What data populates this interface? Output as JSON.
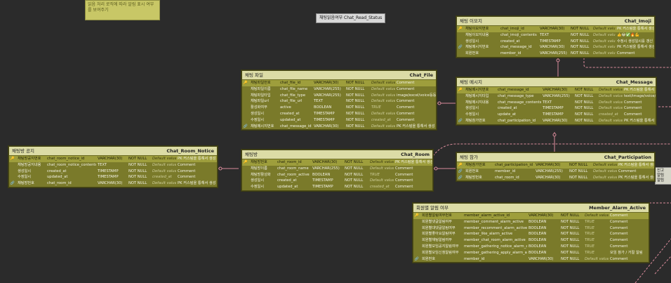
{
  "sticky_note": {
    "text": "읽음 처리 로직에 따라 알림 표시 여부를 보여주기"
  },
  "diagram_label": {
    "text": "채팅읽음여부   Chat_Read_Status"
  },
  "entities": {
    "chat_imoji": {
      "logical": "채팅 이모지",
      "physical": "Chat_Imoji",
      "rows": [
        {
          "key": "pk",
          "name": "채팅이모지번호",
          "col": "chat_imoji_id",
          "type": "VARCHAR(30)",
          "nn": "NOT NULL",
          "dv": "Default value",
          "comment": "PK 커스텀을 통해서 생성"
        },
        {
          "key": "",
          "name": "채팅이모지내용",
          "col": "chat_imoji_contents",
          "type": "TEXT",
          "nn": "NOT NULL",
          "dv": "Default value",
          "comment": "👍😂✅🔥💪"
        },
        {
          "key": "",
          "name": "생성일시",
          "col": "created_at",
          "type": "TIMESTAMP",
          "nn": "NOT NULL",
          "dv": "Default value",
          "comment": "수정시 생성일시를 갱신"
        },
        {
          "key": "fk",
          "name": "채팅메시지번호",
          "col": "chat_message_id",
          "type": "VARCHAR(30)",
          "nn": "NOT NULL",
          "dv": "Default value",
          "comment": "PK 커스텀을 통해서 생성"
        },
        {
          "key": "",
          "name": "회원번호",
          "col": "member_id",
          "type": "VARCHAR(255)",
          "nn": "NOT NULL",
          "dv": "Default value",
          "comment": "Comment"
        }
      ]
    },
    "chat_file": {
      "logical": "채팅 파일",
      "physical": "Chat_File",
      "rows": [
        {
          "key": "pk",
          "name": "채팅파일번호",
          "col": "chat_file_id",
          "type": "VARCHAR(30)",
          "nn": "NOT NULL",
          "dv": "Default value",
          "comment": "Comment"
        },
        {
          "key": "",
          "name": "채팅파일이름",
          "col": "chat_file_name",
          "type": "VARCHAR(255)",
          "nn": "NOT NULL",
          "dv": "Default value",
          "comment": "Comment"
        },
        {
          "key": "",
          "name": "채팅파일타입",
          "col": "chat_file_type",
          "type": "VARCHAR(255)",
          "nn": "NOT NULL",
          "dv": "Default value",
          "comment": "image/excel/voice등등"
        },
        {
          "key": "",
          "name": "채팅파일url",
          "col": "chat_file_url",
          "type": "TEXT",
          "nn": "NOT NULL",
          "dv": "Default value",
          "comment": "Comment"
        },
        {
          "key": "",
          "name": "활성화여부",
          "col": "active",
          "type": "BOOLEAN",
          "nn": "NOT NULL",
          "dv": "TRUE",
          "comment": "Comment"
        },
        {
          "key": "",
          "name": "생성일시",
          "col": "created_at",
          "type": "TIMESTAMP",
          "nn": "NOT NULL",
          "dv": "Default value",
          "comment": "Comment"
        },
        {
          "key": "",
          "name": "수정일시",
          "col": "updated_at",
          "type": "TIMESTAMP",
          "nn": "NOT NULL",
          "dv": "created_at",
          "comment": "Comment"
        },
        {
          "key": "fk",
          "name": "채팅메시지번호",
          "col": "chat_message_id",
          "type": "VARCHAR(30)",
          "nn": "NOT NULL",
          "dv": "Default value",
          "comment": "PK 커스텀을 통해서 생성"
        }
      ]
    },
    "chat_message": {
      "logical": "채팅 메시지",
      "physical": "Chat_Message",
      "rows": [
        {
          "key": "pk",
          "name": "채팅메시지번호",
          "col": "chat_message_id",
          "type": "VARCHAR(30)",
          "nn": "NOT NULL",
          "dv": "Default value",
          "comment": "PK 커스텀을 통해서 생성"
        },
        {
          "key": "",
          "name": "채팅메시지타입",
          "col": "chat_message_type",
          "type": "VARCHAR(255)",
          "nn": "NOT NULL",
          "dv": "Default value",
          "comment": "text/image/voice/URL"
        },
        {
          "key": "",
          "name": "채팅메시지내용",
          "col": "chat_message_contents",
          "type": "TEXT",
          "nn": "NOT NULL",
          "dv": "Default value",
          "comment": "Comment"
        },
        {
          "key": "",
          "name": "생성일시",
          "col": "created_at",
          "type": "TIMESTAMP",
          "nn": "NOT NULL",
          "dv": "Default value",
          "comment": "Comment"
        },
        {
          "key": "",
          "name": "수정일시",
          "col": "update_at",
          "type": "TIMESTAMP",
          "nn": "NOT NULL",
          "dv": "created_at",
          "comment": "Comment"
        },
        {
          "key": "fk",
          "name": "채팅참가번호",
          "col": "chat_participation_id",
          "type": "VARCHAR(30)",
          "nn": "NOT NULL",
          "dv": "Default value",
          "comment": "PK 커스텀을 통해서 생성"
        }
      ]
    },
    "chat_room_notice": {
      "logical": "채팅방 공지",
      "physical": "Chat_Room_Notice",
      "rows": [
        {
          "key": "pk",
          "name": "채팅방공지번호",
          "col": "chat_room_notice_id",
          "type": "VARCHAR(30)",
          "nn": "NOT NULL",
          "dv": "Default value",
          "comment": "PK 커스텀을 통해서 생성"
        },
        {
          "key": "",
          "name": "채팅방공지내용",
          "col": "chat_room_notice_contents",
          "type": "TEXT",
          "nn": "NOT NULL",
          "dv": "Default value",
          "comment": "Comment"
        },
        {
          "key": "",
          "name": "생성일시",
          "col": "created_at",
          "type": "TIMESTAMP",
          "nn": "NOT NULL",
          "dv": "Default value",
          "comment": "Comment"
        },
        {
          "key": "",
          "name": "수정일시",
          "col": "updated_at",
          "type": "TIMESTAMP",
          "nn": "NOT NULL",
          "dv": "created_at",
          "comment": "Comment"
        },
        {
          "key": "fk",
          "name": "채팅방번호",
          "col": "chat_room_id",
          "type": "VARCHAR(30)",
          "nn": "NOT NULL",
          "dv": "Default value",
          "comment": "PK 커스텀을 통해서 생성"
        }
      ]
    },
    "chat_room": {
      "logical": "채팅방",
      "physical": "Chat_Room",
      "rows": [
        {
          "key": "pk",
          "name": "채팅방번호",
          "col": "chat_room_id",
          "type": "VARCHAR(30)",
          "nn": "NOT NULL",
          "dv": "Default value",
          "comment": "PK 커스텀을 통해서 생성"
        },
        {
          "key": "",
          "name": "채팅방이름",
          "col": "chat_room_name",
          "type": "VARCHAR(255)",
          "nn": "NOT NULL",
          "dv": "Default value",
          "comment": "Comment"
        },
        {
          "key": "",
          "name": "채팅방활성화",
          "col": "chat_room_active",
          "type": "BOOLEAN",
          "nn": "NOT NULL",
          "dv": "TRUE",
          "comment": "Comment"
        },
        {
          "key": "",
          "name": "생성일시",
          "col": "created_at",
          "type": "TIMESTAMP",
          "nn": "NOT NULL",
          "dv": "Default value",
          "comment": "Comment"
        },
        {
          "key": "",
          "name": "수정일시",
          "col": "updated_at",
          "type": "TIMESTAMP",
          "nn": "NOT NULL",
          "dv": "created_at",
          "comment": "Comment"
        }
      ]
    },
    "chat_participation": {
      "logical": "채팅 참가",
      "physical": "Chat_Participation",
      "rows": [
        {
          "key": "pk",
          "name": "채팅참가번호",
          "col": "chat_participation_id",
          "type": "VARCHAR(30)",
          "nn": "NOT NULL",
          "dv": "Default value",
          "comment": "PK 커스텀을 통해서 생성"
        },
        {
          "key": "fk",
          "name": "회원번호",
          "col": "member_id",
          "type": "VARCHAR(255)",
          "nn": "NOT NULL",
          "dv": "Default value",
          "comment": "Comment"
        },
        {
          "key": "fk",
          "name": "채팅방번호",
          "col": "chat_room_id",
          "type": "VARCHAR(30)",
          "nn": "NOT NULL",
          "dv": "Default value",
          "comment": "PK 커스텀을 통해서 생성"
        }
      ]
    },
    "member_alarm_active": {
      "logical": "회원별 알림 여부",
      "physical": "Member_Alarm_Active",
      "rows": [
        {
          "key": "pk",
          "name": "회원별알림여부번호",
          "col": "member_alarm_active_id",
          "type": "VARCHAR(30)",
          "nn": "NOT NULL",
          "dv": "Default value",
          "comment": "Comment"
        },
        {
          "key": "",
          "name": "회원별댓글알림여부",
          "col": "member_comment_alarm_active",
          "type": "BOOLEAN",
          "nn": "NOT NULL",
          "dv": "TRUE",
          "comment": "Comment"
        },
        {
          "key": "",
          "name": "회원별대댓글알림여부",
          "col": "member_recomment_alarm_active",
          "type": "BOOLEAN",
          "nn": "NOT NULL",
          "dv": "TRUE",
          "comment": "Comment"
        },
        {
          "key": "",
          "name": "회원별좋아요알림여부",
          "col": "member_like_alarm_active",
          "type": "BOOLEAN",
          "nn": "NOT NULL",
          "dv": "TRUE",
          "comment": "Comment"
        },
        {
          "key": "",
          "name": "회원별채팅알림여부",
          "col": "member_chat_room_alarm_active",
          "type": "BOOLEAN",
          "nn": "NOT NULL",
          "dv": "TRUE",
          "comment": "Comment"
        },
        {
          "key": "",
          "name": "회원별모임공지알림여부",
          "col": "member_gathering_notice_alarm_active",
          "type": "BOOLEAN",
          "nn": "NOT NULL",
          "dv": "TRUE",
          "comment": "Comment"
        },
        {
          "key": "",
          "name": "회원별모임신청알림여부",
          "col": "member_gathering_apply_alarm_active",
          "type": "BOOLEAN",
          "nn": "NOT NULL",
          "dv": "TRUE",
          "comment": "모임 참가 / 거절 알림"
        },
        {
          "key": "fk",
          "name": "회원번호",
          "col": "member_id",
          "type": "VARCHAR(30)",
          "nn": "NOT NULL",
          "dv": "Default value",
          "comment": "Comment"
        }
      ]
    }
  },
  "edge_note": {
    "lines": [
      "신고",
      "알림",
      "알림"
    ]
  }
}
